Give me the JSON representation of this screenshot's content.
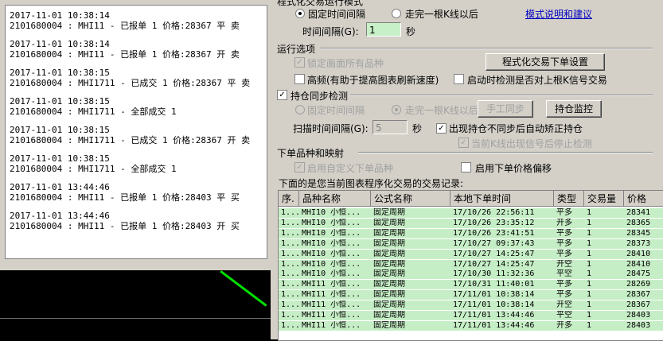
{
  "log": {
    "entries": [
      {
        "time": "2017-11-01 10:38:14",
        "msg": "2101680004 : MHI11 - 已报单 1 价格:28367 平 卖"
      },
      {
        "time": "2017-11-01 10:38:14",
        "msg": "2101680004 : MHI11 - 已报单 1 价格:28367 开 卖"
      },
      {
        "time": "2017-11-01 10:38:15",
        "msg": "2101680004 : MHI1711 - 已成交 1 价格:28367 平 卖"
      },
      {
        "time": "2017-11-01 10:38:15",
        "msg": "2101680004 : MHI1711 - 全部成交 1"
      },
      {
        "time": "2017-11-01 10:38:15",
        "msg": "2101680004 : MHI1711 - 已成交 1 价格:28367 开 卖"
      },
      {
        "time": "2017-11-01 10:38:15",
        "msg": "2101680004 : MHI1711 - 全部成交 1"
      },
      {
        "time": "2017-11-01 13:44:46",
        "msg": "2101680004 : MHI11 - 已报单 1 价格:28403 平 买"
      },
      {
        "time": "2017-11-01 13:44:46",
        "msg": "2101680004 : MHI11 - 已报单 1 价格:28403 开 买"
      }
    ]
  },
  "panel": {
    "mode_title": "程式化交易运行模式",
    "radio_fixed_interval": "固定时间间隔",
    "radio_after_bar": "走完一根K线以后",
    "mode_help_link": "模式说明和建议",
    "interval_label": "时间间隔(G):",
    "interval_value": "1",
    "interval_unit": "秒",
    "run_options_title": "运行选项",
    "lock_all_symbols": "锁定画面所有品种",
    "order_settings_button": "程式化交易下单设置",
    "high_freq": "高频(有助于提高图表刷新速度)",
    "startup_check": "启动时检测是否对上根K信号交易",
    "position_sync_title": "持仓同步检测",
    "sync_fixed_interval": "固定时间间隔",
    "sync_after_bar": "走完一根K线以后",
    "manual_sync_button": "手工同步",
    "position_monitor_button": "持仓监控",
    "scan_interval_label": "扫描时间间隔(G):",
    "scan_interval_value": "5",
    "scan_interval_unit": "秒",
    "auto_correct": "出现持仓不同步后自动矫正持仓",
    "stop_check": "当前K线出现信号后停止检测",
    "order_mapping_title": "下单品种和映射",
    "custom_symbol": "启用自定义下单品种",
    "price_offset": "启用下单价格偏移",
    "records_caption": "下面的是您当前图表程序化交易的交易记录:"
  },
  "table": {
    "headers": [
      "序.",
      "品种名称",
      "公式名称",
      "本地下单时间",
      "类型",
      "交易量",
      "价格"
    ],
    "rows": [
      [
        "1...",
        "MHI10 小恒...",
        "固定周期",
        "17/10/26 22:56:11",
        "平多",
        "1",
        "28341"
      ],
      [
        "1...",
        "MHI10 小恒...",
        "固定周期",
        "17/10/26 23:35:12",
        "开多",
        "1",
        "28365"
      ],
      [
        "1...",
        "MHI10 小恒...",
        "固定周期",
        "17/10/26 23:41:51",
        "平多",
        "1",
        "28345"
      ],
      [
        "1...",
        "MHI10 小恒...",
        "固定周期",
        "17/10/27 09:37:43",
        "平多",
        "1",
        "28373"
      ],
      [
        "1...",
        "MHI10 小恒...",
        "固定周期",
        "17/10/27 14:25:47",
        "平多",
        "1",
        "28410"
      ],
      [
        "1...",
        "MHI10 小恒...",
        "固定周期",
        "17/10/27 14:25:47",
        "开空",
        "1",
        "28410"
      ],
      [
        "1...",
        "MHI10 小恒...",
        "固定周期",
        "17/10/30 11:32:36",
        "平空",
        "1",
        "28475"
      ],
      [
        "1...",
        "MHI11 小恒...",
        "固定周期",
        "17/10/31 11:40:01",
        "平多",
        "1",
        "28269"
      ],
      [
        "1...",
        "MHI11 小恒...",
        "固定周期",
        "17/11/01 10:38:14",
        "平多",
        "1",
        "28367"
      ],
      [
        "1...",
        "MHI11 小恒...",
        "固定周期",
        "17/11/01 10:38:14",
        "开空",
        "1",
        "28367"
      ],
      [
        "1...",
        "MHI11 小恒...",
        "固定周期",
        "17/11/01 13:44:46",
        "平空",
        "1",
        "28403"
      ],
      [
        "1...",
        "MHI11 小恒...",
        "固定周期",
        "17/11/01 13:44:46",
        "开多",
        "1",
        "28403"
      ]
    ]
  },
  "colors": {
    "row_bg": "#c6eec6",
    "chart_line": "#00e000"
  }
}
